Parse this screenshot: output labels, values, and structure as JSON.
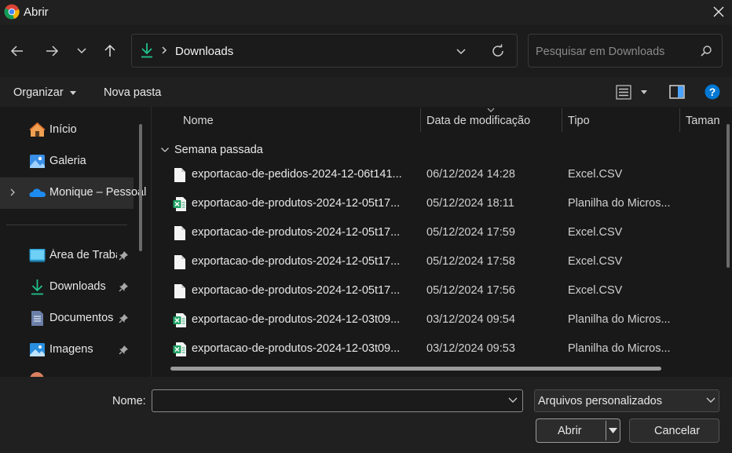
{
  "window": {
    "title": "Abrir"
  },
  "address": {
    "current": "Downloads"
  },
  "search": {
    "placeholder": "Pesquisar em Downloads"
  },
  "toolbar": {
    "organize": "Organizar",
    "new_folder": "Nova pasta"
  },
  "sidebar": {
    "items": [
      {
        "label": "Início",
        "icon": "home-icon"
      },
      {
        "label": "Galeria",
        "icon": "gallery-icon"
      },
      {
        "label": "Monique – Pessoal",
        "icon": "onedrive-icon"
      },
      {
        "label": "Área de Trabalho",
        "icon": "desktop-icon",
        "pinned": true
      },
      {
        "label": "Downloads",
        "icon": "download-icon",
        "pinned": true
      },
      {
        "label": "Documentos",
        "icon": "documents-icon",
        "pinned": true
      },
      {
        "label": "Imagens",
        "icon": "pictures-icon",
        "pinned": true
      }
    ]
  },
  "columns": {
    "name": "Nome",
    "date": "Data de modificação",
    "type": "Tipo",
    "size": "Taman"
  },
  "group": {
    "label": "Semana passada"
  },
  "files": [
    {
      "name": "exportacao-de-pedidos-2024-12-06t141...",
      "date": "06/12/2024 14:28",
      "type": "Excel.CSV",
      "icon": "csv-file-icon"
    },
    {
      "name": "exportacao-de-produtos-2024-12-05t17...",
      "date": "05/12/2024 18:11",
      "type": "Planilha do Micros...",
      "icon": "excel-file-icon"
    },
    {
      "name": "exportacao-de-produtos-2024-12-05t17...",
      "date": "05/12/2024 17:59",
      "type": "Excel.CSV",
      "icon": "csv-file-icon"
    },
    {
      "name": "exportacao-de-produtos-2024-12-05t17...",
      "date": "05/12/2024 17:58",
      "type": "Excel.CSV",
      "icon": "csv-file-icon"
    },
    {
      "name": "exportacao-de-produtos-2024-12-05t17...",
      "date": "05/12/2024 17:56",
      "type": "Excel.CSV",
      "icon": "csv-file-icon"
    },
    {
      "name": "exportacao-de-produtos-2024-12-03t09...",
      "date": "03/12/2024 09:54",
      "type": "Planilha do Micros...",
      "icon": "excel-file-icon"
    },
    {
      "name": "exportacao-de-produtos-2024-12-03t09...",
      "date": "03/12/2024 09:53",
      "type": "Planilha do Micros...",
      "icon": "excel-file-icon"
    }
  ],
  "footer": {
    "name_label": "Nome:",
    "name_value": "",
    "filter": "Arquivos personalizados",
    "open": "Abrir",
    "cancel": "Cancelar"
  },
  "colors": {
    "accent": "#0078d4",
    "background": "#191919",
    "excel_green": "#21a366"
  }
}
